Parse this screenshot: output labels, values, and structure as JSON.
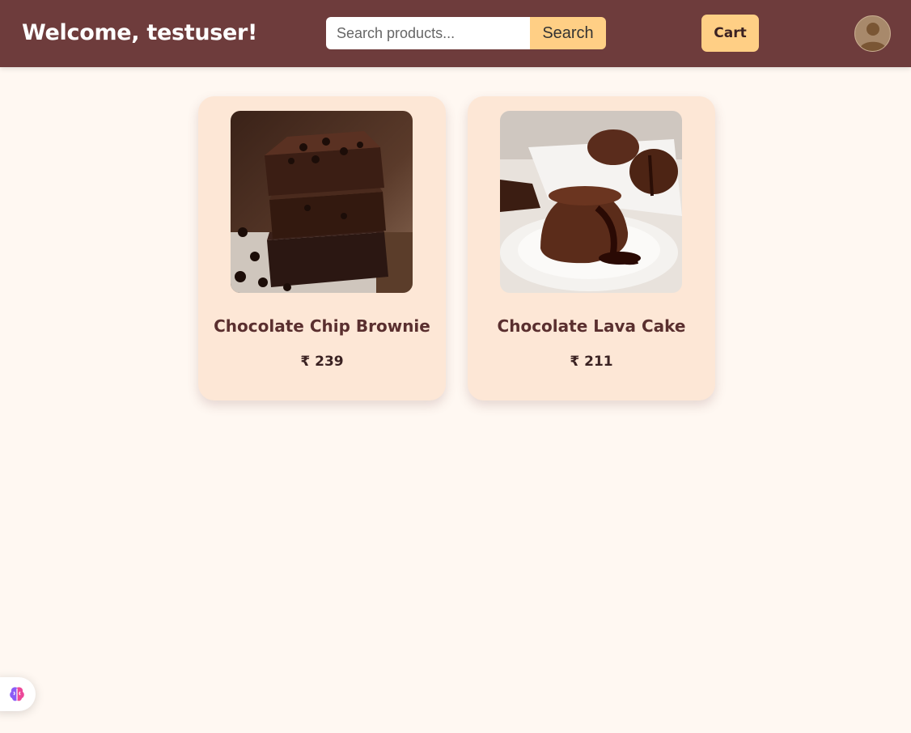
{
  "header": {
    "welcome": "Welcome, testuser!",
    "search_placeholder": "Search products...",
    "search_value": "",
    "search_label": "Search",
    "cart_label": "Cart",
    "avatar_icon": "user-avatar-icon"
  },
  "products": [
    {
      "name": "Chocolate Chip Brownie",
      "price": "₹ 239",
      "image": "brownie-stack-image"
    },
    {
      "name": "Chocolate Lava Cake",
      "price": "₹ 211",
      "image": "lava-cake-image"
    }
  ],
  "widget": {
    "icon": "brain-icon"
  },
  "colors": {
    "header_bg": "#6e3c3c",
    "accent": "#ffcf85",
    "page_bg": "#fff8f2",
    "card_bg": "#fde7d6",
    "title_text": "#5a2f2f"
  }
}
